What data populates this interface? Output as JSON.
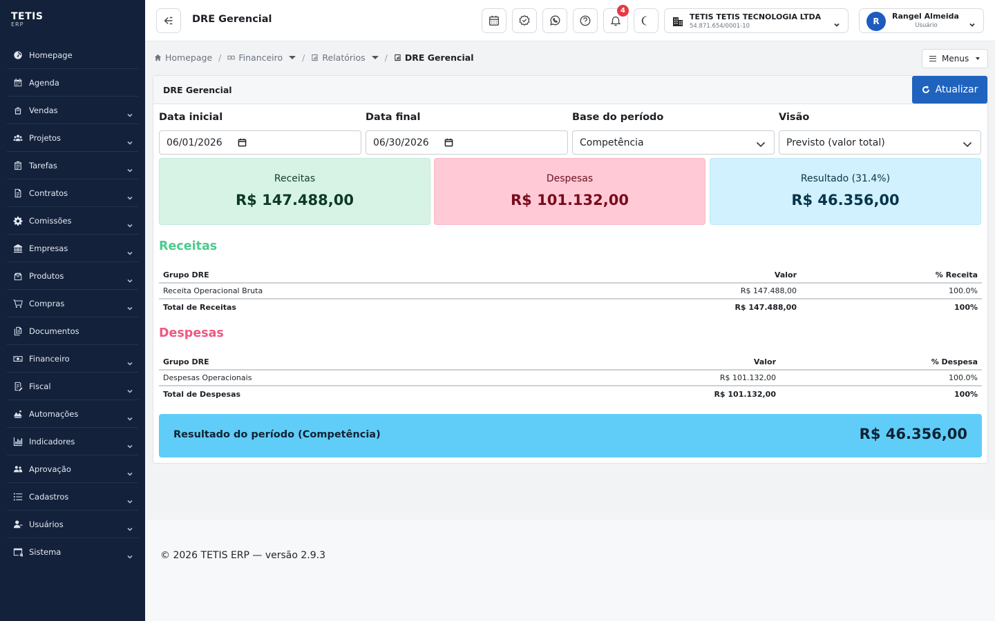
{
  "brand": {
    "name": "TETIS",
    "sub": "ERP"
  },
  "sidebar": {
    "items": [
      {
        "label": "Homepage",
        "icon": "speedometer-icon",
        "chevron": false
      },
      {
        "label": "Agenda",
        "icon": "calendar-icon",
        "chevron": false
      },
      {
        "label": "Vendas",
        "icon": "bag-icon",
        "chevron": true
      },
      {
        "label": "Projetos",
        "icon": "people-icon",
        "chevron": true
      },
      {
        "label": "Tarefas",
        "icon": "clipboard-icon",
        "chevron": true
      },
      {
        "label": "Contratos",
        "icon": "document-icon",
        "chevron": true
      },
      {
        "label": "Comissões",
        "icon": "gear-icon",
        "chevron": true
      },
      {
        "label": "Empresas",
        "icon": "bank-icon",
        "chevron": true
      },
      {
        "label": "Produtos",
        "icon": "box-icon",
        "chevron": true
      },
      {
        "label": "Compras",
        "icon": "cart-icon",
        "chevron": true
      },
      {
        "label": "Documentos",
        "icon": "files-icon",
        "chevron": false
      },
      {
        "label": "Financeiro",
        "icon": "cash-icon",
        "chevron": true
      },
      {
        "label": "Fiscal",
        "icon": "receipt-icon",
        "chevron": true
      },
      {
        "label": "Automações",
        "icon": "robot-icon",
        "chevron": true
      },
      {
        "label": "Indicadores",
        "icon": "bar-chart-icon",
        "chevron": true
      },
      {
        "label": "Aprovação",
        "icon": "team-icon",
        "chevron": true
      },
      {
        "label": "Cadastros",
        "icon": "list-icon",
        "chevron": true
      },
      {
        "label": "Usuários",
        "icon": "user-icon",
        "chevron": true
      },
      {
        "label": "Sistema",
        "icon": "system-gear-icon",
        "chevron": true
      }
    ]
  },
  "header": {
    "title": "DRE Gerencial",
    "notifications_count": "4",
    "company_name": "TETIS TETIS TECNOLOGIA LTDA",
    "company_cnpj": "54.871.654/0001-10",
    "user_initial": "R",
    "user_name": "Rangel Almeida",
    "user_role": "Usuário"
  },
  "breadcrumb": {
    "home": "Homepage",
    "financeiro": "Financeiro",
    "relatorios": "Relatórios",
    "current": "DRE Gerencial",
    "sep": "/"
  },
  "menus_label": "Menus",
  "card": {
    "title": "DRE Gerencial",
    "refresh_label": "Atualizar"
  },
  "filters": {
    "start_label": "Data inicial",
    "start_value": "06/01/2026",
    "end_label": "Data final",
    "end_value": "06/30/2026",
    "base_label": "Base do período",
    "base_value": "Competência",
    "view_label": "Visão",
    "view_value": "Previsto (valor total)"
  },
  "kpis": {
    "receitas_label": "Receitas",
    "receitas_value": "R$ 147.488,00",
    "despesas_label": "Despesas",
    "despesas_value": "R$ 101.132,00",
    "resultado_label": "Resultado (31.4%)",
    "resultado_value": "R$ 46.356,00"
  },
  "receitas": {
    "title": "Receitas",
    "col_group": "Grupo DRE",
    "col_value": "Valor",
    "col_pct": "% Receita",
    "rows": [
      {
        "group": "Receita Operacional Bruta",
        "value": "R$ 147.488,00",
        "pct": "100.0%"
      }
    ],
    "total_label": "Total de Receitas",
    "total_value": "R$ 147.488,00",
    "total_pct": "100%"
  },
  "despesas": {
    "title": "Despesas",
    "col_group": "Grupo DRE",
    "col_value": "Valor",
    "col_pct": "% Despesa",
    "rows": [
      {
        "group": "Despesas Operacionais",
        "value": "R$ 101.132,00",
        "pct": "100.0%"
      }
    ],
    "total_label": "Total de Despesas",
    "total_value": "R$ 101.132,00",
    "total_pct": "100%"
  },
  "result": {
    "label": "Resultado do período (Competência)",
    "value": "R$ 46.356,00"
  },
  "footer": {
    "text": "© 2026 TETIS ERP — versão 2.9.3"
  },
  "colors": {
    "sidebar_bg": "#13213b",
    "primary": "#1f63bf",
    "receitas_green": "#4ccb8c",
    "despesas_pink": "#f0577f",
    "kpi_receitas_bg": "#d6f3e6",
    "kpi_despesas_bg": "#ffcad5",
    "kpi_resultado_bg": "#d0f1fd",
    "result_bar_bg": "#5fcdf8",
    "badge_red": "#e53945"
  }
}
